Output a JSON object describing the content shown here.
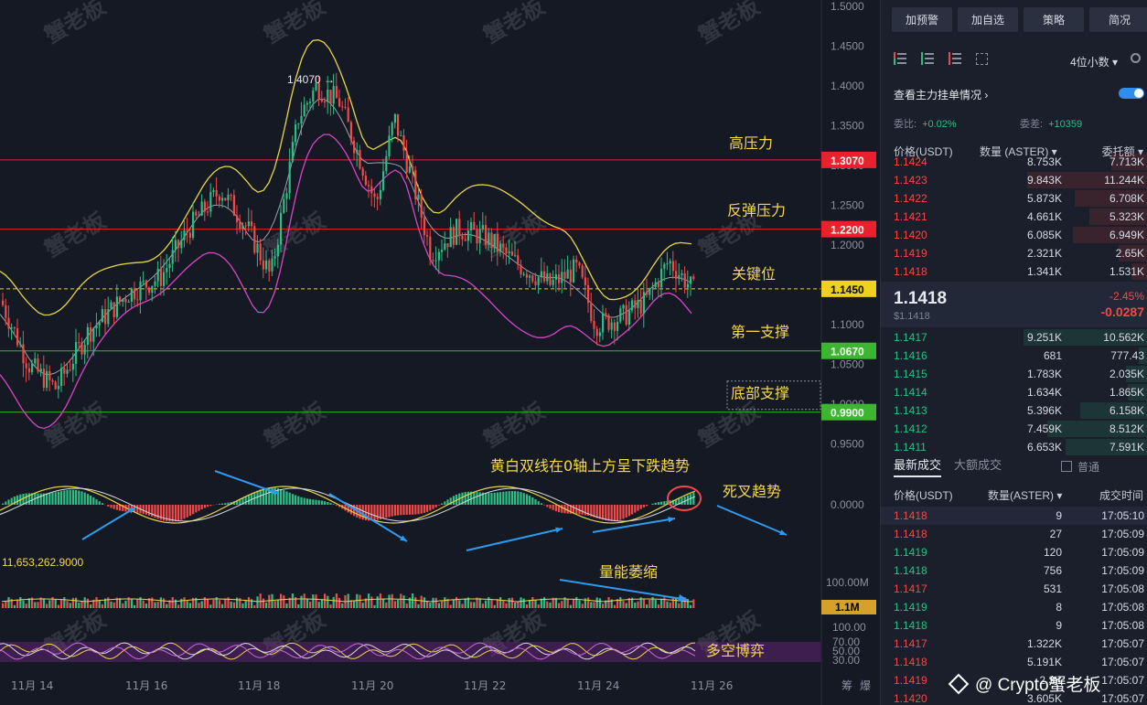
{
  "chart": {
    "price_axis": [
      "1.5000",
      "1.4500",
      "1.4000",
      "1.3500",
      "1.3000",
      "1.2500",
      "1.2000",
      "1.1500",
      "1.1000",
      "1.0500",
      "1.0000",
      "0.9500"
    ],
    "levels": [
      {
        "label": "高压力",
        "value": "1.3070",
        "tag_color": "#e8212c"
      },
      {
        "label": "反弹压力",
        "value": "1.2200",
        "tag_color": "#e8212c"
      },
      {
        "label": "关键位",
        "value": "1.1450",
        "tag_color": "#f0d020"
      },
      {
        "label": "第一支撑",
        "value": "1.0670",
        "tag_color": "#3cb531"
      },
      {
        "label": "底部支撑",
        "value": "0.9900",
        "tag_color": "#3cb531"
      }
    ],
    "high_label": "1.4070 →",
    "macd_label": "黄白双线在0轴上方呈下跌趋势",
    "macd_zero": "0.0000",
    "death_cross": "死叉趋势",
    "macd_value": "11,653,262.9000",
    "volume_label": "量能萎缩",
    "volume_axis": "100.00M",
    "volume_tag": "1.1M",
    "rsi_label": "多空博弈",
    "rsi_axis": [
      "100.00",
      "70.00",
      "50.00",
      "30.00"
    ],
    "dates": [
      "11月 14",
      "11月 16",
      "11月 18",
      "11月 20",
      "11月 22",
      "11月 24",
      "11月 26"
    ],
    "corner": [
      "筹",
      "爆"
    ],
    "watermark": "蟹老板"
  },
  "toolbar": [
    "加预警",
    "加自选",
    "策略",
    "简况"
  ],
  "orderbook": {
    "decimal": "4位小数",
    "depth_title": "查看主力挂单情况",
    "ratio_label": "委比:",
    "ratio_value": "+0.02%",
    "diff_label": "委差:",
    "diff_value": "+10359",
    "col_price": "价格(USDT)",
    "col_qty": "数量 (ASTER)",
    "col_total": "委托额",
    "asks": [
      {
        "p": "1.1424",
        "q": "8.753K",
        "t": "7.713K",
        "w": 0.2
      },
      {
        "p": "1.1423",
        "q": "9.843K",
        "t": "11.244K",
        "w": 0.66
      },
      {
        "p": "1.1422",
        "q": "5.873K",
        "t": "6.708K",
        "w": 0.4
      },
      {
        "p": "1.1421",
        "q": "4.661K",
        "t": "5.323K",
        "w": 0.32
      },
      {
        "p": "1.1420",
        "q": "6.085K",
        "t": "6.949K",
        "w": 0.41
      },
      {
        "p": "1.1419",
        "q": "2.321K",
        "t": "2.65K",
        "w": 0.16
      },
      {
        "p": "1.1418",
        "q": "1.341K",
        "t": "1.531K",
        "w": 0.09
      }
    ],
    "last_price": "1.1418",
    "last_usd": "$1.1418",
    "last_pct": "-2.45%",
    "last_chg": "-0.0287",
    "bids": [
      {
        "p": "1.1417",
        "q": "9.251K",
        "t": "10.562K",
        "w": 0.68
      },
      {
        "p": "1.1416",
        "q": "681",
        "t": "777.43",
        "w": 0.05
      },
      {
        "p": "1.1415",
        "q": "1.783K",
        "t": "2.035K",
        "w": 0.12
      },
      {
        "p": "1.1414",
        "q": "1.634K",
        "t": "1.865K",
        "w": 0.11
      },
      {
        "p": "1.1413",
        "q": "5.396K",
        "t": "6.158K",
        "w": 0.37
      },
      {
        "p": "1.1412",
        "q": "7.459K",
        "t": "8.512K",
        "w": 0.55
      },
      {
        "p": "1.1411",
        "q": "6.653K",
        "t": "7.591K",
        "w": 0.45
      }
    ]
  },
  "trades": {
    "tab_latest": "最新成交",
    "tab_large": "大额成交",
    "normal": "普通",
    "col_price": "价格(USDT)",
    "col_qty": "数量(ASTER)",
    "col_time": "成交时间",
    "rows": [
      {
        "p": "1.1418",
        "q": "9",
        "t": "17:05:10",
        "side": "sell"
      },
      {
        "p": "1.1418",
        "q": "27",
        "t": "17:05:09",
        "side": "sell"
      },
      {
        "p": "1.1419",
        "q": "120",
        "t": "17:05:09",
        "side": "buy"
      },
      {
        "p": "1.1418",
        "q": "756",
        "t": "17:05:09",
        "side": "buy"
      },
      {
        "p": "1.1417",
        "q": "531",
        "t": "17:05:08",
        "side": "sell"
      },
      {
        "p": "1.1419",
        "q": "8",
        "t": "17:05:08",
        "side": "buy"
      },
      {
        "p": "1.1418",
        "q": "9",
        "t": "17:05:08",
        "side": "buy"
      },
      {
        "p": "1.1417",
        "q": "1.322K",
        "t": "17:05:07",
        "side": "sell"
      },
      {
        "p": "1.1418",
        "q": "5.191K",
        "t": "17:05:07",
        "side": "sell"
      },
      {
        "p": "1.1419",
        "q": "2.3K",
        "t": "17:05:07",
        "side": "sell"
      },
      {
        "p": "1.1420",
        "q": "3.605K",
        "t": "17:05:07",
        "side": "sell"
      }
    ]
  },
  "footer_watermark": "@ Crypto蟹老板",
  "colors": {
    "up": "#2ebd85",
    "down": "#f04a4a",
    "accent": "#2d8ef0",
    "yellow": "#f0d020"
  }
}
